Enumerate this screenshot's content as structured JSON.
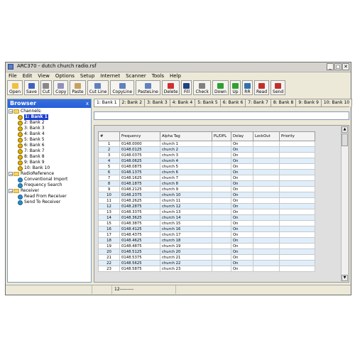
{
  "window": {
    "title": "ARC370 - dutch church radio.rsf"
  },
  "menu": [
    "File",
    "Edit",
    "View",
    "Options",
    "Setup",
    "Internet",
    "Scanner",
    "Tools",
    "Help"
  ],
  "toolbar": [
    {
      "name": "open",
      "label": "Open",
      "color": "#f0c040"
    },
    {
      "name": "save",
      "label": "Save",
      "color": "#4060c0"
    },
    {
      "name": "cut",
      "label": "Cut",
      "color": "#888888"
    },
    {
      "name": "copy",
      "label": "Copy",
      "color": "#9090c0"
    },
    {
      "name": "paste",
      "label": "Paste",
      "color": "#c8a060"
    },
    {
      "name": "cutline",
      "label": "Cut Line",
      "color": "#6080c0"
    },
    {
      "name": "copyline",
      "label": "CopyLine",
      "color": "#6080c0"
    },
    {
      "name": "pasteline",
      "label": "PasteLine",
      "color": "#6080c0"
    },
    {
      "name": "delete",
      "label": "Delete",
      "color": "#d03030"
    },
    {
      "name": "fill",
      "label": "Fill",
      "color": "#204080"
    },
    {
      "name": "check",
      "label": "Check",
      "color": "#808080"
    },
    {
      "name": "down",
      "label": "Down",
      "color": "#30a030"
    },
    {
      "name": "up",
      "label": "Up",
      "color": "#30a030"
    },
    {
      "name": "rr",
      "label": "RR",
      "color": "#3070b0"
    },
    {
      "name": "read",
      "label": "Read",
      "color": "#c03030"
    },
    {
      "name": "send",
      "label": "Send",
      "color": "#c03030"
    }
  ],
  "browser": {
    "title": "Browser",
    "close": "x",
    "channels_label": "Channels:",
    "banks": [
      "1: Bank 1",
      "2: Bank 2",
      "3: Bank 3",
      "4: Bank 4",
      "5: Bank 5",
      "6: Bank 6",
      "7: Bank 7",
      "8: Bank 8",
      "9: Bank 9",
      "10: Bank 10"
    ],
    "radioref": "RadioReference",
    "conv_import": "Conventional Import",
    "freq_search": "Frequency Search",
    "receiver": "Receiver",
    "read_from": "Read From Receiver",
    "send_to": "Send To Receiver"
  },
  "tabs": [
    "1: Bank 1",
    "2: Bank 2",
    "3: Bank 3",
    "4: Bank 4",
    "5: Bank 5",
    "6: Bank 6",
    "7: Bank 7",
    "8: Bank 8",
    "9: Bank 9",
    "10: Bank 10"
  ],
  "grid": {
    "headers": [
      "#",
      "Frequency",
      "Alpha Tag",
      "PL/DPL",
      "Delay",
      "LockOut",
      "Priority"
    ],
    "rows": [
      [
        "1",
        "0148.0000",
        "church 1",
        "",
        "On",
        "",
        ""
      ],
      [
        "2",
        "0148.0125",
        "church 2",
        "",
        "On",
        "",
        ""
      ],
      [
        "3",
        "0148.0375",
        "church 3",
        "",
        "On",
        "",
        ""
      ],
      [
        "4",
        "0148.0625",
        "church 4",
        "",
        "On",
        "",
        ""
      ],
      [
        "5",
        "0148.0875",
        "church 5",
        "",
        "On",
        "",
        ""
      ],
      [
        "6",
        "0148.1375",
        "church 6",
        "",
        "On",
        "",
        ""
      ],
      [
        "7",
        "0148.1625",
        "church 7",
        "",
        "On",
        "",
        ""
      ],
      [
        "8",
        "0148.1875",
        "church 8",
        "",
        "On",
        "",
        ""
      ],
      [
        "9",
        "0148.2125",
        "church 9",
        "",
        "On",
        "",
        ""
      ],
      [
        "10",
        "0148.2375",
        "church 10",
        "",
        "On",
        "",
        ""
      ],
      [
        "11",
        "0148.2625",
        "church 11",
        "",
        "On",
        "",
        ""
      ],
      [
        "12",
        "0148.2875",
        "church 12",
        "",
        "On",
        "",
        ""
      ],
      [
        "13",
        "0148.3375",
        "church 13",
        "",
        "On",
        "",
        ""
      ],
      [
        "14",
        "0148.3625",
        "church 14",
        "",
        "On",
        "",
        ""
      ],
      [
        "15",
        "0148.3875",
        "church 15",
        "",
        "On",
        "",
        ""
      ],
      [
        "16",
        "0148.4125",
        "church 16",
        "",
        "On",
        "",
        ""
      ],
      [
        "17",
        "0148.4375",
        "church 17",
        "",
        "On",
        "",
        ""
      ],
      [
        "18",
        "0148.4625",
        "church 18",
        "",
        "On",
        "",
        ""
      ],
      [
        "19",
        "0148.4875",
        "church 19",
        "",
        "On",
        "",
        ""
      ],
      [
        "20",
        "0148.5125",
        "church 20",
        "",
        "On",
        "",
        ""
      ],
      [
        "21",
        "0148.5375",
        "church 21",
        "",
        "On",
        "",
        ""
      ],
      [
        "22",
        "0148.5625",
        "church 22",
        "",
        "On",
        "",
        ""
      ],
      [
        "23",
        "0148.5875",
        "church 23",
        "",
        "On",
        "",
        ""
      ]
    ]
  },
  "status": {
    "cell3": "12---------"
  }
}
